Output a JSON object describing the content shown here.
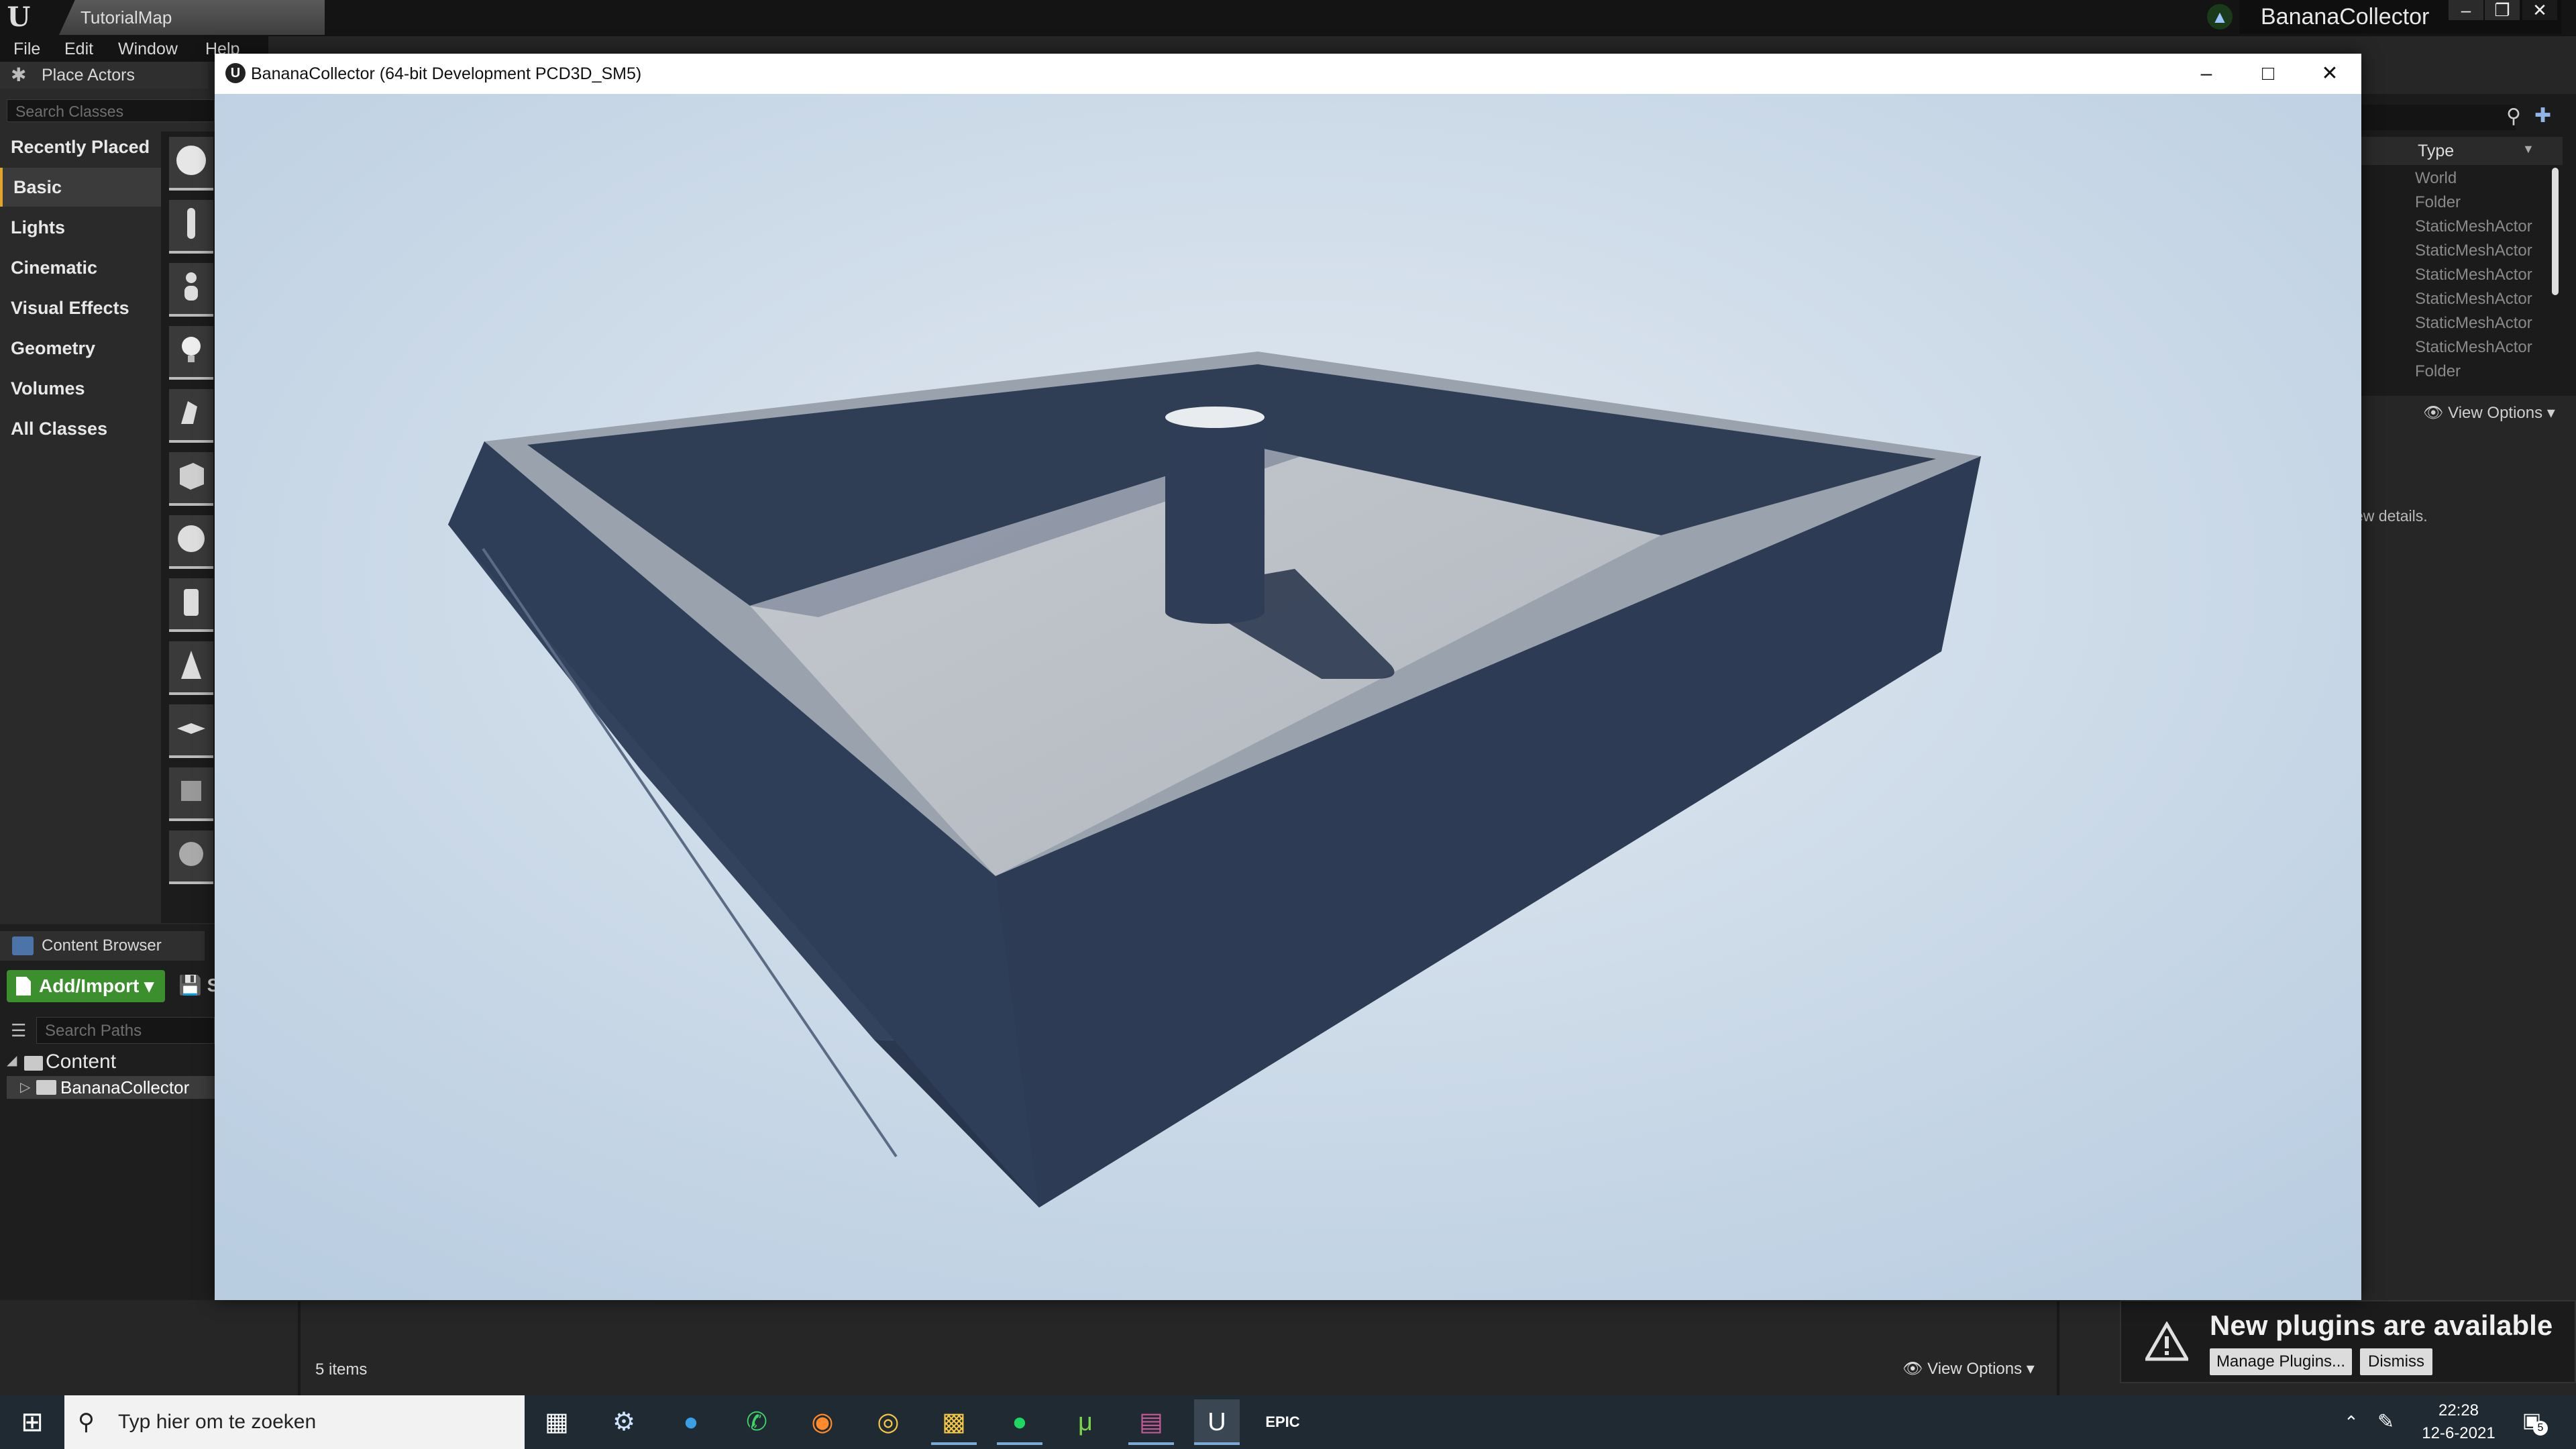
{
  "editor": {
    "level_tab": "TutorialMap",
    "project_name": "BananaCollector",
    "menu": [
      "File",
      "Edit",
      "Window",
      "Help"
    ]
  },
  "place_actors": {
    "title": "Place Actors",
    "search_placeholder": "Search Classes",
    "categories": [
      "Recently Placed",
      "Basic",
      "Lights",
      "Cinematic",
      "Visual Effects",
      "Geometry",
      "Volumes",
      "All Classes"
    ],
    "active_category": "Basic"
  },
  "content_browser": {
    "title": "Content Browser",
    "add_import_label": "Add/Import",
    "save_label": "S",
    "search_paths_placeholder": "Search Paths",
    "tree": {
      "root": "Content",
      "child": "BananaCollector"
    },
    "items_count": "5 items",
    "view_options": "View Options"
  },
  "outliner": {
    "type_header": "Type",
    "types": [
      "World",
      "Folder",
      "StaticMeshActor",
      "StaticMeshActor",
      "StaticMeshActor",
      "StaticMeshActor",
      "StaticMeshActor",
      "StaticMeshActor",
      "Folder"
    ],
    "view_options": "View Options"
  },
  "details": {
    "hint_fragment": "ew details."
  },
  "notification": {
    "title": "New plugins are available",
    "manage_label": "Manage Plugins...",
    "dismiss_label": "Dismiss"
  },
  "game_window": {
    "title": "BananaCollector (64-bit Development PCD3D_SM5)",
    "minimize_glyph": "–",
    "maximize_glyph": "□",
    "close_glyph": "✕"
  },
  "taskbar": {
    "search_placeholder": "Typ hier om te zoeken",
    "time": "22:28",
    "date": "12-6-2021",
    "notification_count": "5",
    "apps": [
      "task-view",
      "steam",
      "edge",
      "whatsapp",
      "firefox",
      "chrome",
      "file-explorer",
      "spotify",
      "utorrent",
      "winrar",
      "unreal-engine",
      "epic-games"
    ]
  },
  "colors": {
    "sky": "#c9d9e8",
    "wall": "#2e3d57",
    "floor": "#b9bfc8",
    "accent_green": "#3b8f2c",
    "active_category": "#e2a42b"
  }
}
